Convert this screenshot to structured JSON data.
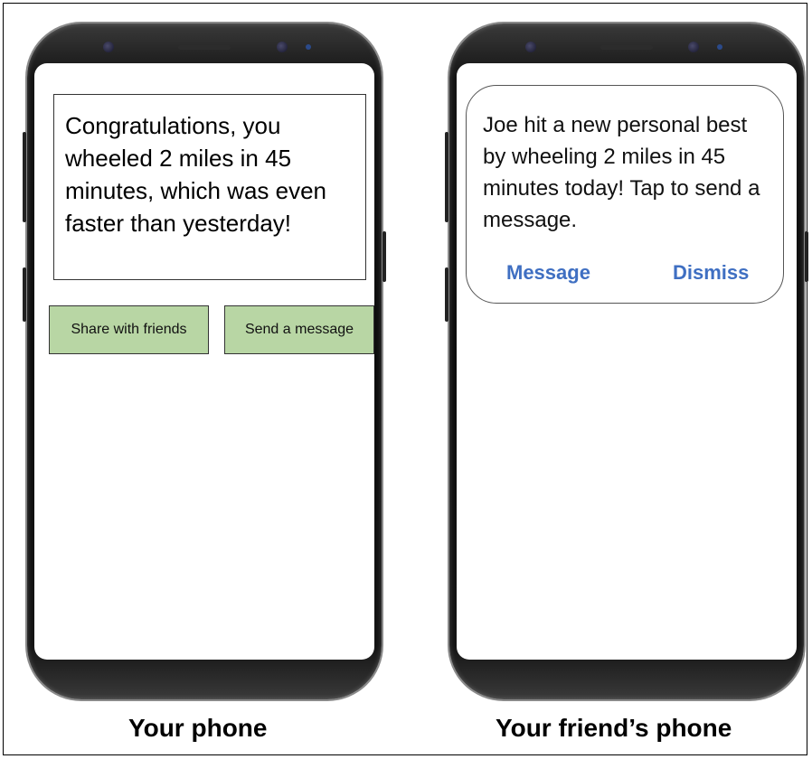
{
  "your_phone": {
    "message": "Congratulations, you wheeled 2 miles in 45 minutes, which was even faster than yesterday!",
    "share_button": "Share with friends",
    "message_button": "Send a message",
    "caption": "Your phone"
  },
  "friend_phone": {
    "notification": "Joe hit a new personal best by wheeling 2 miles in 45 minutes today! Tap to send a message.",
    "message_button": "Message",
    "dismiss_button": "Dismiss",
    "caption": "Your friend’s phone"
  },
  "colors": {
    "action_button_bg": "#b8d6a4",
    "notification_link": "#3f6fc2",
    "phone_body": "#0d0d0d"
  }
}
